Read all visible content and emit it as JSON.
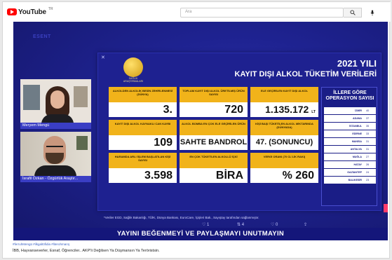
{
  "browser": {
    "logo_text": "YouTube",
    "logo_country": "TR",
    "search_placeholder": "Ara"
  },
  "watermark": "ESENT",
  "webcams": [
    {
      "name_label": "Meryem Mengü"
    },
    {
      "name_label": "İsrafil Özkan - Özgürlük Araştır..."
    }
  ],
  "panel": {
    "year": "2021 YILI",
    "title": "KAYIT DIŞI ALKOL TÜKETİM VERİLERİ",
    "logo_caption": "SAĞLIK ARAŞTIRMALARI",
    "stats": [
      {
        "label": "ALKOLDEN ALKOLİK BESİN ZEHİRLENMESİ (DÜNYA)",
        "value": "3."
      },
      {
        "label": "TOPLAM KAYIT DIŞI ALKOL ÜRETİLMİŞ ÜRÜN SAYISI",
        "value": "720"
      },
      {
        "label": "ELE GEÇİRİLEN KAYIT DIŞI ALKOL",
        "value": "1.135.172",
        "unit": "LT"
      },
      {
        "label": "KAYIT DIŞI ALKOL KAYNAKLI CAN KAYBI",
        "value": "109"
      },
      {
        "label": "ALKOL BOMBA EN ÇOK ELE GEÇİRİLEN ÜRÜN",
        "value": "SAHTE BANDROL"
      },
      {
        "label": "KİŞİ BAŞI TÜKETİLEN ALKOL MİKTARINDA (DÜNYADA)",
        "value": "47. (SONUNCU)"
      },
      {
        "label": "HARAMDA ARLI İŞLEM BAŞLATILAN KİŞİ SAYISI",
        "value": "3.598"
      },
      {
        "label": "EN ÇOK TÜKETİLEN ALKOLLÜ İÇKİ",
        "value": "BİRA"
      },
      {
        "label": "VERGİ ORANI (70 CL'LİK RAKI)",
        "value": "% 260"
      }
    ],
    "provinces_title": "İLLERE GÖRE OPERASYON SAYISI",
    "provinces": [
      {
        "name": "İZMİR",
        "count": "40"
      },
      {
        "name": "ADANA",
        "count": "37"
      },
      {
        "name": "İSTANBUL",
        "count": "35"
      },
      {
        "name": "EDİRNE",
        "count": "33"
      },
      {
        "name": "MANİSA",
        "count": "31"
      },
      {
        "name": "ANTALYA",
        "count": "31"
      },
      {
        "name": "MUĞLA",
        "count": "27"
      },
      {
        "name": "HATAY",
        "count": "26"
      },
      {
        "name": "GAZİANTEP",
        "count": "24"
      },
      {
        "name": "BALIKESİR",
        "count": "23"
      }
    ],
    "source": "*Veriler EGD, Sağlık Bakanlığı, TÜİK, Dünya Bankası, EuroCare, İçişleri Bak., Sayıştay tarafından sağlanmıştır.",
    "controls": [
      "♡ 1",
      "⇅ 4",
      "♡ 0",
      "⇪"
    ]
  },
  "banner": "YAYINI BEĞENMEYİ VE PAYLAŞMAYI UNUTMAYIN",
  "below": {
    "tags": "#ferruhMengü #ilkgaltöfidia #literohmarış",
    "title": "İBB, Hayvanseverler, Esnaf, Öğrenciler.. AKP'li Değilsen Ya Düşmansın Ya Teröristsin."
  }
}
